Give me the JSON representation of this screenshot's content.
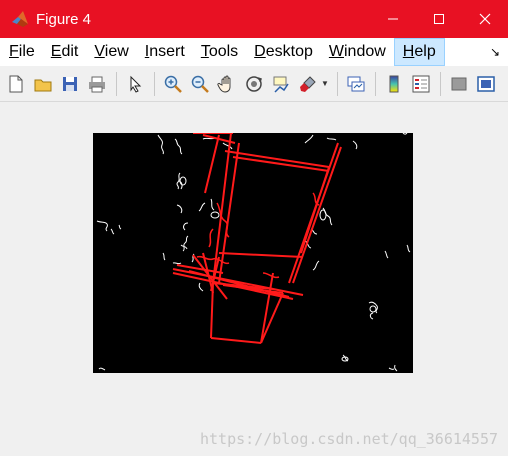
{
  "window": {
    "title": "Figure 4",
    "minimize": "—",
    "maximize": "☐",
    "close": "✕"
  },
  "menubar": {
    "items": [
      {
        "key": "F",
        "rest": "ile"
      },
      {
        "key": "E",
        "rest": "dit"
      },
      {
        "key": "V",
        "rest": "iew"
      },
      {
        "key": "I",
        "rest": "nsert"
      },
      {
        "key": "T",
        "rest": "ools"
      },
      {
        "key": "D",
        "rest": "esktop"
      },
      {
        "key": "W",
        "rest": "indow"
      },
      {
        "key": "H",
        "rest": "elp"
      }
    ],
    "overflow": "↘"
  },
  "toolbar": {
    "icons": [
      "new-figure-icon",
      "open-file-icon",
      "save-icon",
      "print-icon",
      "pointer-icon",
      "zoom-in-icon",
      "zoom-out-icon",
      "pan-icon",
      "rotate-3d-icon",
      "data-cursor-icon",
      "brush-icon",
      "link-plot-icon",
      "colorbar-icon",
      "legend-icon",
      "hide-plot-tools-icon",
      "show-plot-tools-icon"
    ]
  },
  "colors": {
    "titlebar": "#e81123",
    "edges": "#ffffff",
    "lines": "#ff0000"
  },
  "watermark": "https://blog.csdn.net/qq_36614557"
}
